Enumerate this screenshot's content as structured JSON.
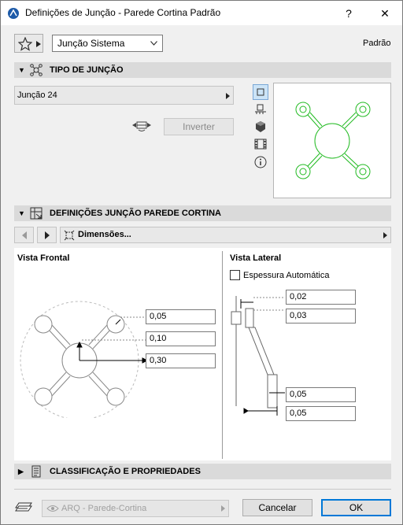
{
  "window": {
    "title": "Definições de Junção - Parede Cortina Padrão",
    "help_label": "?",
    "close_label": "✕"
  },
  "top": {
    "system_select": "Junção Sistema",
    "default_label": "Padrão"
  },
  "section_type": {
    "title": "TIPO DE JUNÇÃO",
    "joint_select": "Junção 24",
    "invert_label": "Inverter"
  },
  "section_settings": {
    "title": "DEFINIÇÕES JUNÇÃO PAREDE CORTINA",
    "page_select": "Dimensões..."
  },
  "front_view": {
    "title": "Vista Frontal",
    "values": [
      "0,05",
      "0,10",
      "0,30"
    ]
  },
  "side_view": {
    "title": "Vista Lateral",
    "auto_thickness_label": "Espessura Automática",
    "values": [
      "0,02",
      "0,03",
      "0,05",
      "0,05"
    ]
  },
  "section_class": {
    "title": "CLASSIFICAÇÃO E PROPRIEDADES"
  },
  "footer": {
    "layer_select": "ARQ - Parede-Cortina",
    "cancel_label": "Cancelar",
    "ok_label": "OK"
  },
  "colors": {
    "preview_green": "#22bb22",
    "ok_border": "#0078d7"
  }
}
